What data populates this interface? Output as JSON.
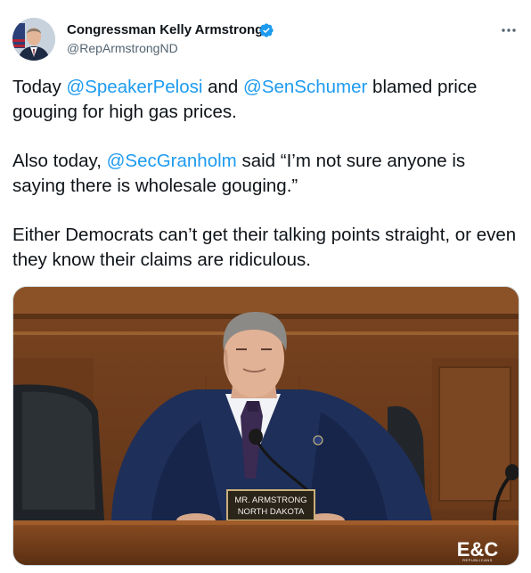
{
  "author": {
    "name": "Congressman Kelly Armstrong",
    "handle": "@RepArmstrongND",
    "verified": true
  },
  "tweet": {
    "p1": {
      "t1": "Today ",
      "m1": "@SpeakerPelosi",
      "t2": " and ",
      "m2": "@SenSchumer",
      "t3": " blamed price gouging for high gas prices."
    },
    "p2": {
      "t1": "Also today, ",
      "m1": "@SecGranholm",
      "t2": " said “I’m not sure anyone is saying there is wholesale gouging.”"
    },
    "p3": {
      "t1": "Either Democrats can’t get their talking points straight, or even they know their claims are ridiculous."
    }
  },
  "media": {
    "placard_line1": "MR. ARMSTRONG",
    "placard_line2": "NORTH DAKOTA",
    "logo": "E&C",
    "logo_sub": "REPUBLICANS"
  },
  "icons": {
    "verified": "verified-badge-icon",
    "more": "more-options-icon"
  },
  "colors": {
    "link": "#1d9bf0",
    "text": "#0f1419",
    "secondary": "#536471"
  }
}
